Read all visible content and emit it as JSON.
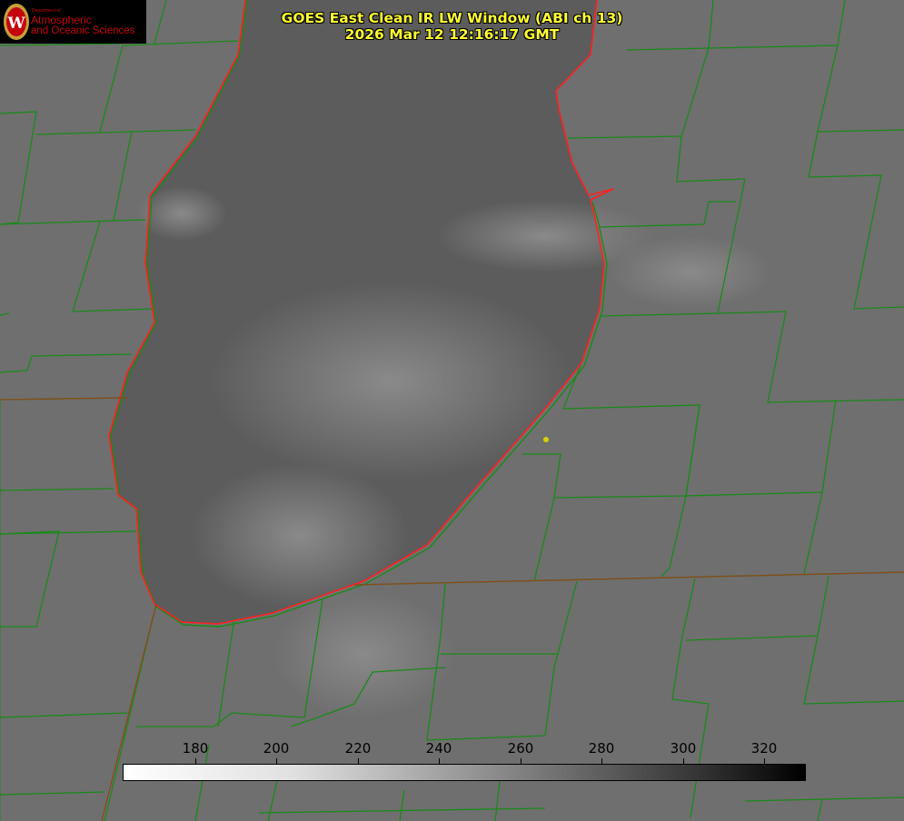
{
  "title": {
    "line1": "GOES East Clean IR LW Window (ABI ch 13)",
    "line2": "2026 Mar 12 12:16:17 GMT"
  },
  "logo": {
    "department": "Department of",
    "line1": "Atmospheric",
    "line2": "and Oceanic Sciences",
    "crest_letter": "W"
  },
  "colorbar": {
    "units_range": [
      162,
      330
    ],
    "ticks": [
      "180",
      "200",
      "220",
      "240",
      "260",
      "280",
      "300",
      "320"
    ],
    "colormap": "white-to-black (inverted grayscale)"
  },
  "colors": {
    "title": "#ffff33",
    "lake_outline": "#ff2020",
    "county_lines": "#1a8a1a",
    "marker": "#d4d400"
  }
}
